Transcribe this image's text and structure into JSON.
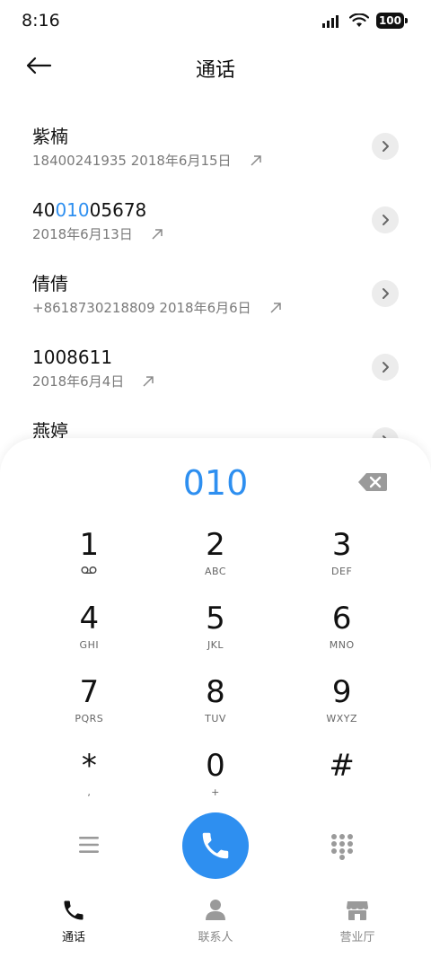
{
  "status_bar": {
    "time": "8:16",
    "battery": "100"
  },
  "header": {
    "title": "通话",
    "back_icon": "arrow-left-icon"
  },
  "calls": [
    {
      "name_parts": [
        "紫楠",
        "",
        ""
      ],
      "meta": "18400241935 2018年6月15日"
    },
    {
      "name_parts": [
        "40",
        "010",
        "05678"
      ],
      "meta": "2018年6月13日"
    },
    {
      "name_parts": [
        "倩倩",
        "",
        ""
      ],
      "meta": "+8618730218809 2018年6月6日"
    },
    {
      "name_parts": [
        "1008611",
        "",
        ""
      ],
      "meta": "2018年6月4日"
    },
    {
      "name_parts": [
        "燕婷",
        "",
        ""
      ],
      "meta": ""
    }
  ],
  "dialpad": {
    "input": "010",
    "keys": [
      {
        "digit": "1",
        "sub": ""
      },
      {
        "digit": "2",
        "sub": "ABC"
      },
      {
        "digit": "3",
        "sub": "DEF"
      },
      {
        "digit": "4",
        "sub": "GHI"
      },
      {
        "digit": "5",
        "sub": "JKL"
      },
      {
        "digit": "6",
        "sub": "MNO"
      },
      {
        "digit": "7",
        "sub": "PQRS"
      },
      {
        "digit": "8",
        "sub": "TUV"
      },
      {
        "digit": "9",
        "sub": "WXYZ"
      },
      {
        "digit": "*",
        "sub": ","
      },
      {
        "digit": "0",
        "sub": "+"
      },
      {
        "digit": "#",
        "sub": ""
      }
    ]
  },
  "tabs": [
    {
      "label": "通话",
      "icon": "phone-icon",
      "active": true
    },
    {
      "label": "联系人",
      "icon": "person-icon",
      "active": false
    },
    {
      "label": "营业厅",
      "icon": "store-icon",
      "active": false
    }
  ],
  "colors": {
    "accent": "#2e8ff0",
    "icon_gray": "#9a9a9a",
    "text_dark": "#111111"
  }
}
